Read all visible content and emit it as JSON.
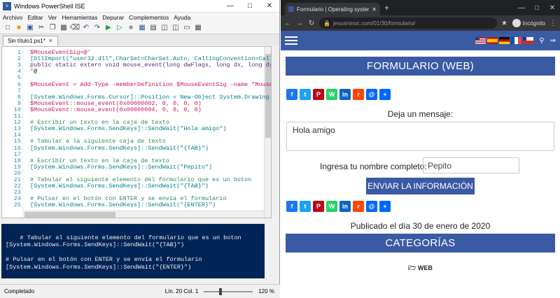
{
  "ise": {
    "title": "Windows PowerShell ISE",
    "menu": [
      "Archivo",
      "Editar",
      "Ver",
      "Herramientas",
      "Depurar",
      "Complementos",
      "Ayuda"
    ],
    "tab_label": "Sin título1.ps1*",
    "code_lines": [
      {
        "n": "1",
        "text": "$MouseEventSig=@'"
      },
      {
        "n": "2",
        "text": "[DllImport(\"user32.dll\",CharSet=CharSet.Auto, CallingConvention=Call"
      },
      {
        "n": "3",
        "text": "public static extern void mouse_event(long dwFlags, long dx, long dy"
      },
      {
        "n": "4",
        "text": "'@"
      },
      {
        "n": "5",
        "text": ""
      },
      {
        "n": "6",
        "text": "$MouseEvent = Add-Type -memberDefinition $MouseEventSig -name \"Mouse"
      },
      {
        "n": "7",
        "text": ""
      },
      {
        "n": "8",
        "text": "[System.Windows.Forms.Cursor]::Position = New-Object System.Drawing."
      },
      {
        "n": "9",
        "text": "$MouseEvent::mouse_event(0x00000002, 0, 0, 0, 0)"
      },
      {
        "n": "10",
        "text": "$MouseEvent::mouse_event(0x00000004, 0, 0, 0, 0)"
      },
      {
        "n": "11",
        "text": ""
      },
      {
        "n": "12",
        "text": "# Escribir un texto en la caja de texto"
      },
      {
        "n": "13",
        "text": "[System.Windows.Forms.SendKeys]::SendWait(\"Hola amigo\")"
      },
      {
        "n": "14",
        "text": ""
      },
      {
        "n": "15",
        "text": "# Tabular a la siguiente caja de texto"
      },
      {
        "n": "16",
        "text": "[System.Windows.Forms.SendKeys]::SendWait(\"{TAB}\")"
      },
      {
        "n": "17",
        "text": ""
      },
      {
        "n": "18",
        "text": "# Escribir un texto en la caja de texto"
      },
      {
        "n": "19",
        "text": "[System.Windows.Forms.SendKeys]::SendWait(\"Pepito\")"
      },
      {
        "n": "20",
        "text": ""
      },
      {
        "n": "21",
        "text": "# Tabular al siguiente elemento del formulario que es un boton"
      },
      {
        "n": "22",
        "text": "[System.Windows.Forms.SendKeys]::SendWait(\"{TAB}\")"
      },
      {
        "n": "23",
        "text": ""
      },
      {
        "n": "24",
        "text": "# Pulsar en el botón con ENTER y se envía el formulario"
      },
      {
        "n": "25",
        "text": "[System.Windows.Forms.SendKeys]::SendWait(\"{ENTER}\")"
      }
    ],
    "console_text": "# Tabular al siguiente elemento del formulario que es un boton\n[System.Windows.Forms.SendKeys]::SendWait(\"{TAB}\")\n\n# Pulsar en el botón con ENTER y se envía el formulario\n[System.Windows.Forms.SendKeys]::SendWait(\"{ENTER}\")\n\nPS C:\\Users\\juan>",
    "status": {
      "left": "Completado",
      "position": "Lín. 20  Col. 1",
      "zoom": "120 %"
    }
  },
  "browser": {
    "tab_title": "Formulario | Operating systems...",
    "url": "jesusninoc.com/01/30/formulario/",
    "incognito_label": "Incógnito"
  },
  "site": {
    "banner": "FORMULARIO (WEB)",
    "message_label": "Deja un mensaje:",
    "message_value": "Hola amigo",
    "name_label": "Ingresa tu nombre completo:",
    "name_value": "Pepito",
    "submit_label": "ENVIAR LA INFORMACIÓN",
    "published": "Publicado el día 30 de enero de 2020",
    "categories_title": "CATEGORÍAS",
    "category_item": "WEB",
    "share_icons": [
      "facebook-icon",
      "twitter-icon",
      "pinterest-icon",
      "whatsapp-icon",
      "linkedin-icon",
      "reddit-icon",
      "email-icon",
      "share-icon"
    ],
    "share_colors": [
      "#1877f2",
      "#1da1f2",
      "#bd081c",
      "#25d366",
      "#0a66c2",
      "#ff4500",
      "#0166ff",
      "#0166ff"
    ],
    "share_glyphs": [
      "f",
      "t",
      "P",
      "W",
      "in",
      "r",
      "@",
      "+"
    ],
    "flags": [
      "us-flag",
      "es-flag",
      "de-flag",
      "fr-flag",
      "cl-flag"
    ]
  }
}
